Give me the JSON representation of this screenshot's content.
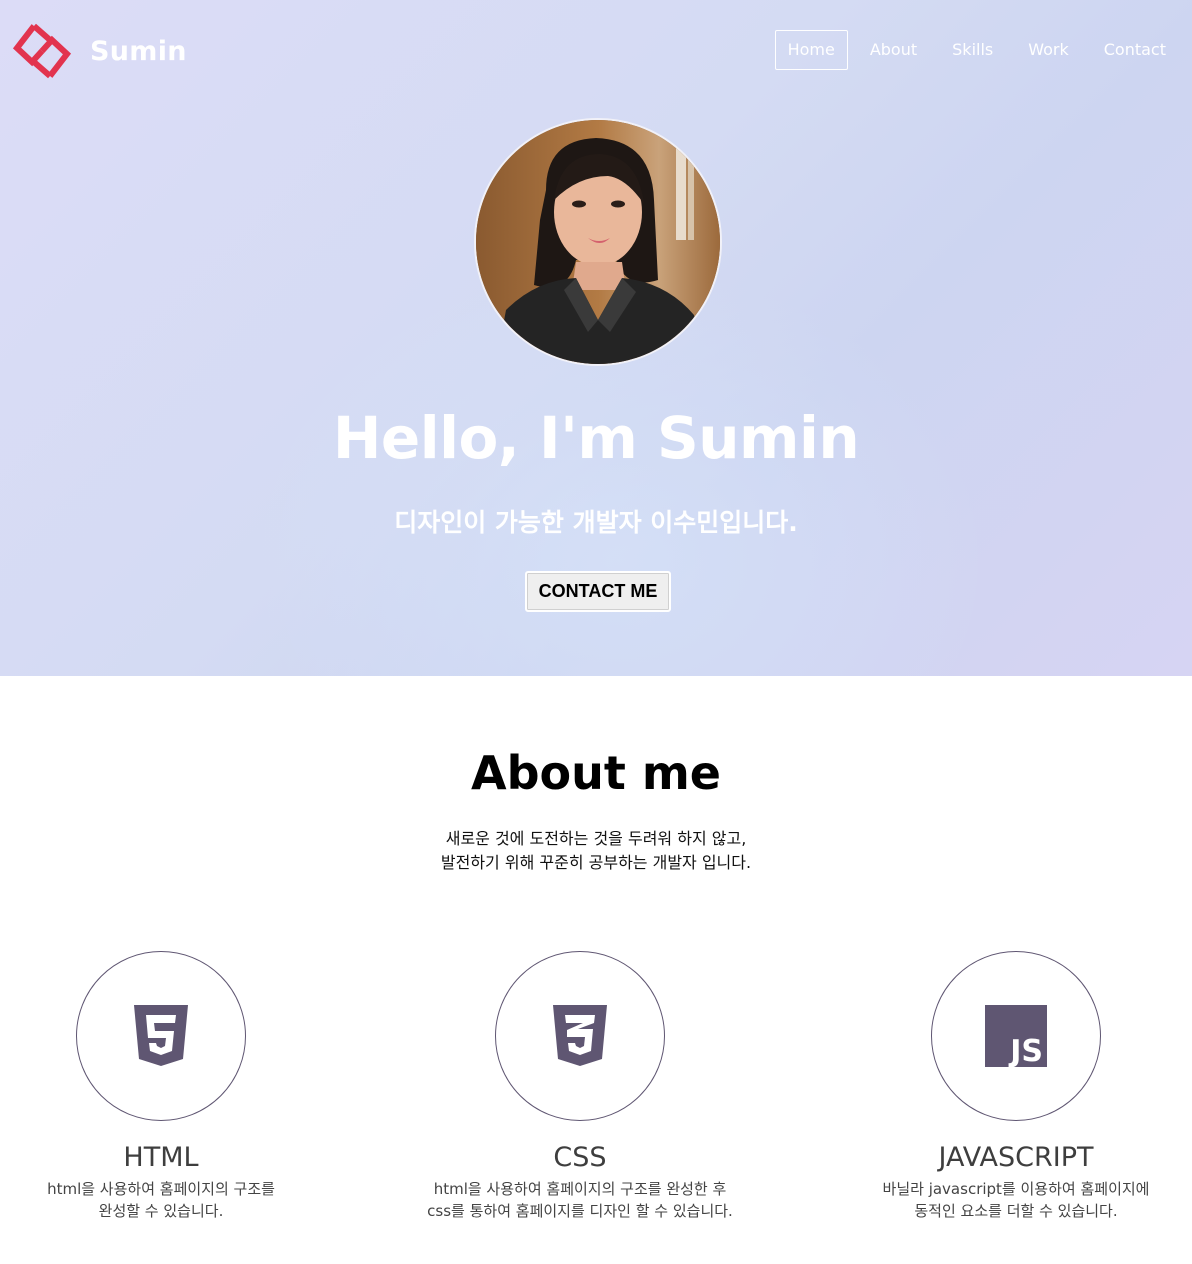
{
  "brand": {
    "name": "Sumin",
    "logo_icon": "diamond-s-logo-icon",
    "logo_color": "#e2334e"
  },
  "nav": {
    "items": [
      {
        "label": "Home",
        "active": true
      },
      {
        "label": "About",
        "active": false
      },
      {
        "label": "Skills",
        "active": false
      },
      {
        "label": "Work",
        "active": false
      },
      {
        "label": "Contact",
        "active": false
      }
    ]
  },
  "hero": {
    "title": "Hello, I'm Sumin",
    "subtitle": "디자인이 가능한 개발자 이수민입니다.",
    "contact_button": "CONTACT ME",
    "gradient_colors": [
      "#dcdcf7",
      "#cdd5f1",
      "#d6d4f3"
    ]
  },
  "about": {
    "title": "About me",
    "description_line1": "새로운 것에 도전하는 것을 두려워 하지 않고,",
    "description_line2": "발전하기 위해 꾸준히 공부하는 개발자 입니다."
  },
  "skills": [
    {
      "name": "HTML",
      "icon": "html5-icon",
      "desc_line1": "html을 사용하여 홈페이지의 구조를",
      "desc_line2": "완성할 수 있습니다."
    },
    {
      "name": "CSS",
      "icon": "css3-icon",
      "desc_line1": "html을 사용하여 홈페이지의 구조를 완성한 후",
      "desc_line2": "css를 통하여 홈페이지를 디자인 할 수 있습니다."
    },
    {
      "name": "JAVASCRIPT",
      "icon": "javascript-icon",
      "desc_line1": "바닐라 javascript를 이용하여 홈페이지에",
      "desc_line2": "동적인 요소를 더할 수 있습니다."
    }
  ],
  "colors": {
    "icon_purple": "#5f5672",
    "skill_text": "#3e3e3e"
  }
}
